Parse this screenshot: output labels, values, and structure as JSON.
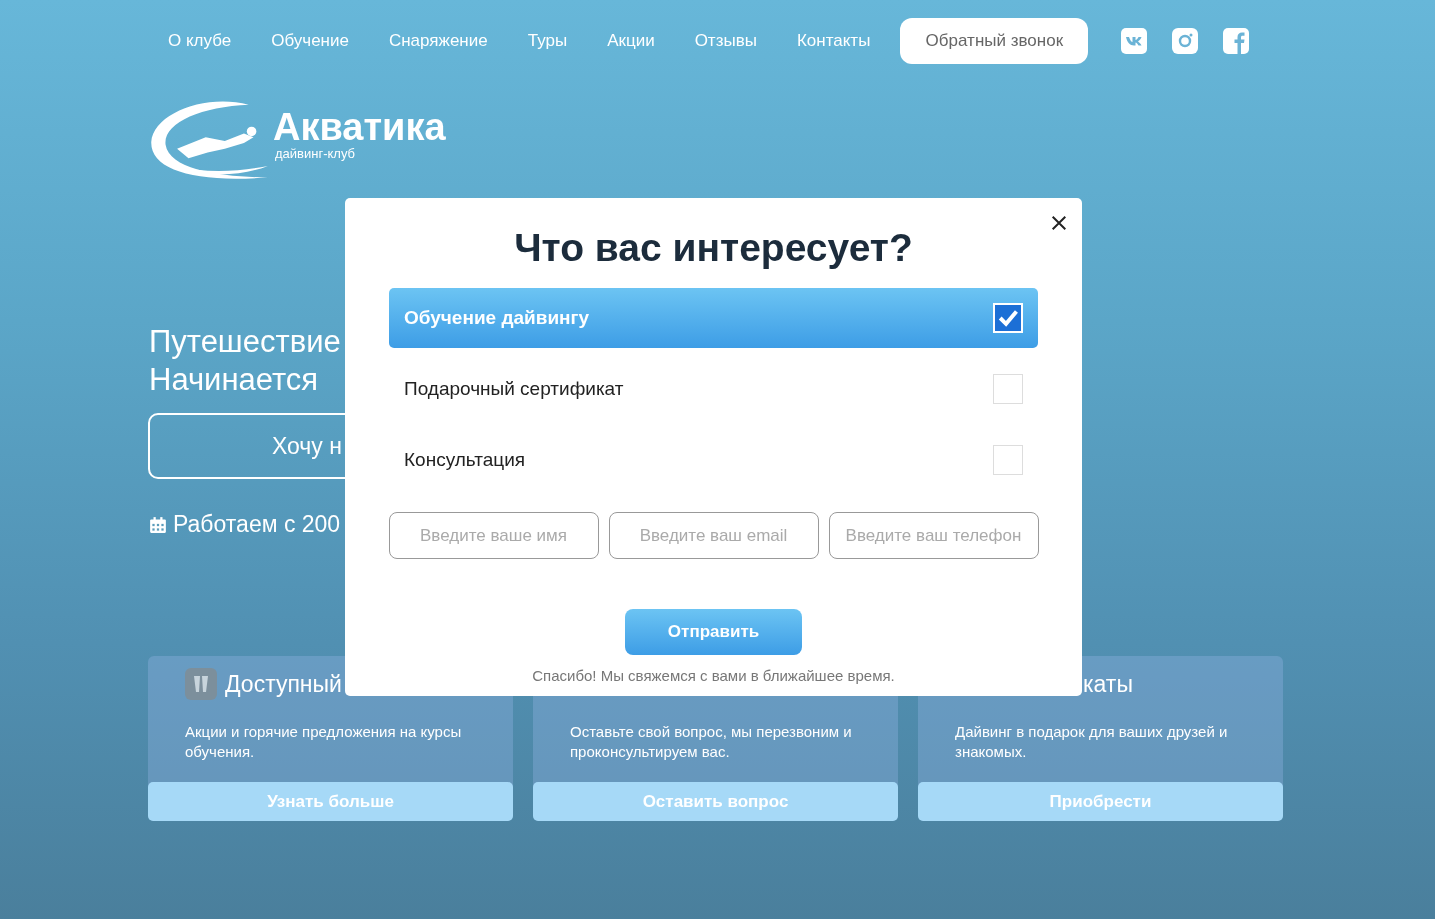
{
  "nav": {
    "links": [
      "О клубе",
      "Обучение",
      "Снаряжение",
      "Туры",
      "Акции",
      "Отзывы",
      "Контакты"
    ],
    "callback_button": "Обратный звонок"
  },
  "logo": {
    "name": "Акватика",
    "tagline": "дайвинг-клуб"
  },
  "hero": {
    "title_lines": [
      "Путешествие",
      "Начинается"
    ],
    "button": "Хочу н",
    "since": "Работаем с 200"
  },
  "cards": [
    {
      "title": "Доступный",
      "has_icon": true,
      "text": "Акции и горячие предложения на курсы обучения.",
      "button": "Узнать больше"
    },
    {
      "has_icon": false,
      "text": "Оставьте свой вопрос, мы перезвоним и проконсультируем вас.",
      "button": "Оставить вопрос"
    },
    {
      "title": "каты",
      "has_icon": false,
      "text": "Дайвинг в подарок для ваших друзей и знакомых.",
      "button": "Приобрести"
    }
  ],
  "modal": {
    "title": "Что вас интересует?",
    "options": [
      {
        "label": "Обучение дайвингу",
        "checked": true
      },
      {
        "label": "Подарочный сертификат",
        "checked": false
      },
      {
        "label": "Консультация",
        "checked": false
      }
    ],
    "fields": [
      {
        "placeholder": "Введите ваше имя"
      },
      {
        "placeholder": "Введите ваш email"
      },
      {
        "placeholder": "Введите ваш телефон"
      }
    ],
    "submit": "Отправить",
    "note": "Спасибо! Мы свяжемся с вами в ближайшее время."
  }
}
